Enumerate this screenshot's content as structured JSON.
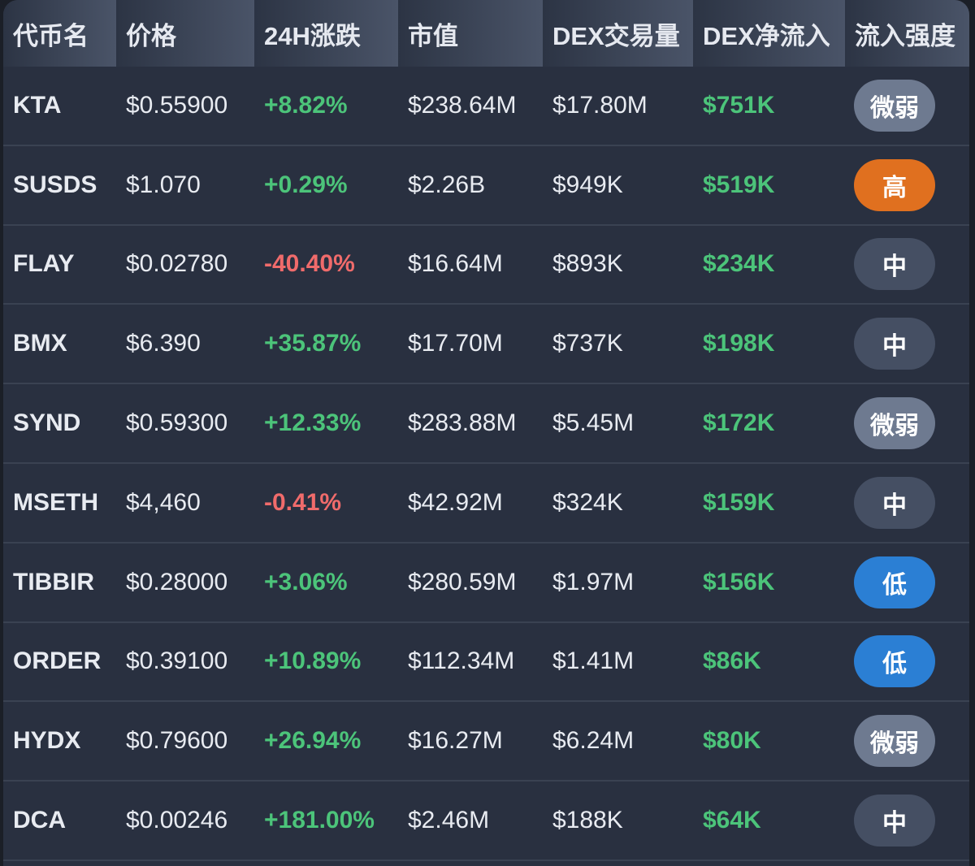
{
  "headers": [
    "代币名",
    "价格",
    "24H涨跌",
    "市值",
    "DEX交易量",
    "DEX净流入",
    "流入强度"
  ],
  "levels": {
    "微弱": "#6e7a90",
    "高": "#e0701f",
    "中": "#454f63",
    "低": "#2b7fd4"
  },
  "rows": [
    {
      "name": "KTA",
      "price": "$0.55900",
      "change": "+8.82%",
      "mcap": "$238.64M",
      "vol": "$17.80M",
      "inflow": "$751K",
      "level": "微弱"
    },
    {
      "name": "SUSDS",
      "price": "$1.070",
      "change": "+0.29%",
      "mcap": "$2.26B",
      "vol": "$949K",
      "inflow": "$519K",
      "level": "高"
    },
    {
      "name": "FLAY",
      "price": "$0.02780",
      "change": "-40.40%",
      "mcap": "$16.64M",
      "vol": "$893K",
      "inflow": "$234K",
      "level": "中"
    },
    {
      "name": "BMX",
      "price": "$6.390",
      "change": "+35.87%",
      "mcap": "$17.70M",
      "vol": "$737K",
      "inflow": "$198K",
      "level": "中"
    },
    {
      "name": "SYND",
      "price": "$0.59300",
      "change": "+12.33%",
      "mcap": "$283.88M",
      "vol": "$5.45M",
      "inflow": "$172K",
      "level": "微弱"
    },
    {
      "name": "MSETH",
      "price": "$4,460",
      "change": "-0.41%",
      "mcap": "$42.92M",
      "vol": "$324K",
      "inflow": "$159K",
      "level": "中"
    },
    {
      "name": "TIBBIR",
      "price": "$0.28000",
      "change": "+3.06%",
      "mcap": "$280.59M",
      "vol": "$1.97M",
      "inflow": "$156K",
      "level": "低"
    },
    {
      "name": "ORDER",
      "price": "$0.39100",
      "change": "+10.89%",
      "mcap": "$112.34M",
      "vol": "$1.41M",
      "inflow": "$86K",
      "level": "低"
    },
    {
      "name": "HYDX",
      "price": "$0.79600",
      "change": "+26.94%",
      "mcap": "$16.27M",
      "vol": "$6.24M",
      "inflow": "$80K",
      "level": "微弱"
    },
    {
      "name": "DCA",
      "price": "$0.00246",
      "change": "+181.00%",
      "mcap": "$2.46M",
      "vol": "$188K",
      "inflow": "$64K",
      "level": "中"
    }
  ]
}
